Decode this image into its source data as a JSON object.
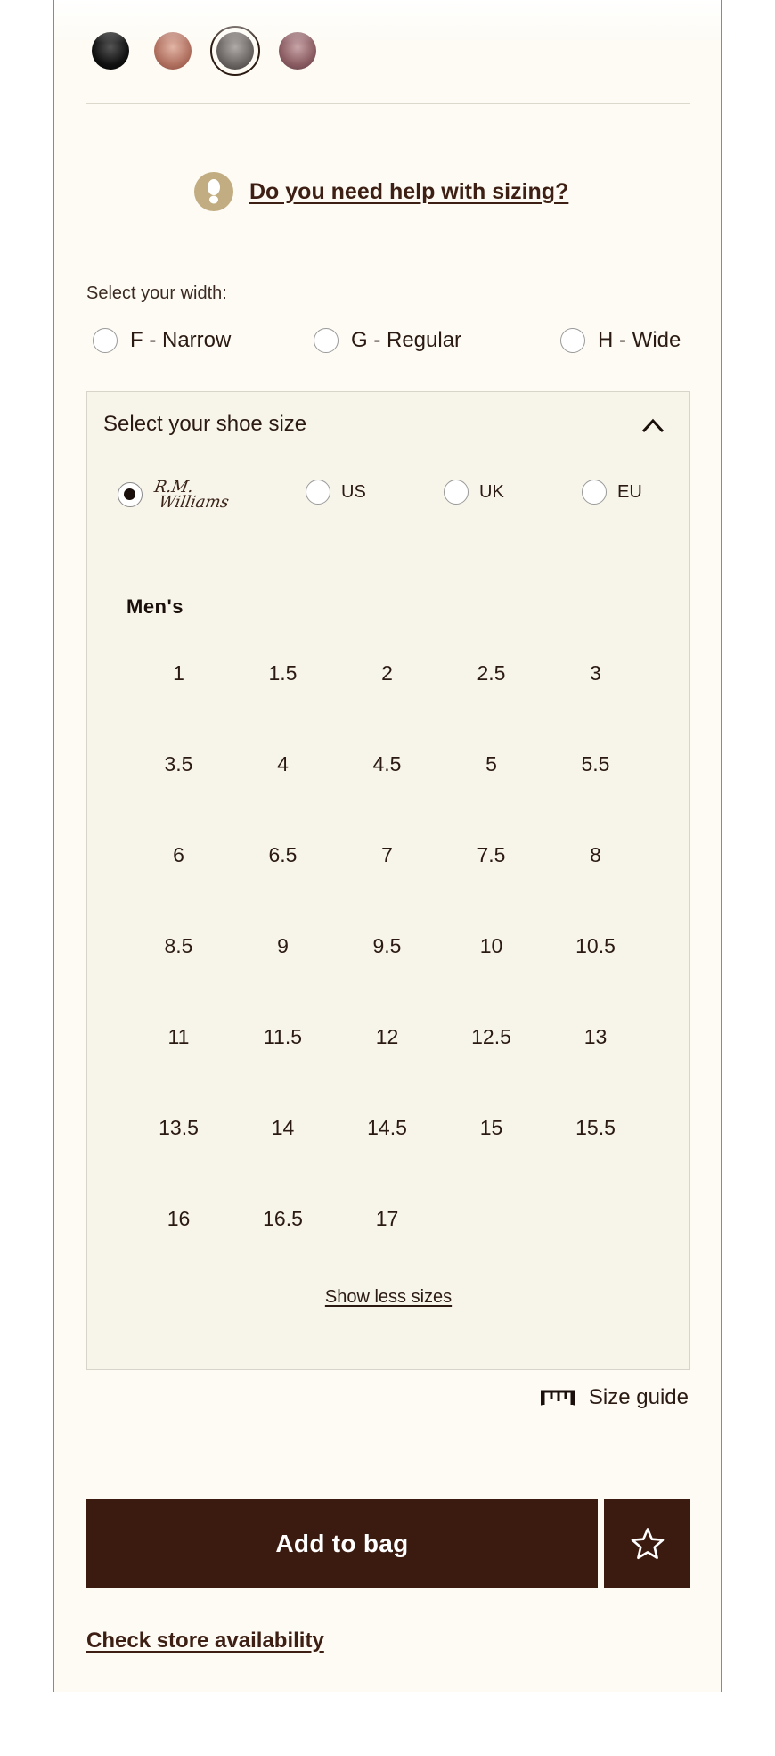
{
  "colors": {
    "accent": "#3b1a0f",
    "page_bg": "#fdfbf4",
    "panel_bg": "#f7f4ea",
    "help_icon_bg": "#c2ad82"
  },
  "swatches": [
    {
      "name": "black"
    },
    {
      "name": "tan"
    },
    {
      "name": "grey",
      "selected": true
    },
    {
      "name": "plum"
    }
  ],
  "help": {
    "icon": "footprint-icon",
    "text": "Do you need help with sizing?"
  },
  "width": {
    "label": "Select your width:",
    "options": [
      "F - Narrow",
      "G - Regular",
      "H - Wide"
    ]
  },
  "size_panel": {
    "heading": "Select your shoe size",
    "chevron_icon": "chevron-up-icon",
    "units": {
      "logo_line1": "R.M.",
      "logo_line2": "Williams",
      "us": "US",
      "uk": "UK",
      "eu": "EU",
      "selected": "R.M. Williams"
    },
    "group_label": "Men's",
    "sizes": [
      "1",
      "1.5",
      "2",
      "2.5",
      "3",
      "3.5",
      "4",
      "4.5",
      "5",
      "5.5",
      "6",
      "6.5",
      "7",
      "7.5",
      "8",
      "8.5",
      "9",
      "9.5",
      "10",
      "10.5",
      "11",
      "11.5",
      "12",
      "12.5",
      "13",
      "13.5",
      "14",
      "14.5",
      "15",
      "15.5",
      "16",
      "16.5",
      "17"
    ],
    "show_less": "Show less sizes"
  },
  "size_guide": {
    "icon": "ruler-icon",
    "label": "Size guide"
  },
  "add_to_bag": "Add to bag",
  "wishlist_icon": "star-icon",
  "store_link": "Check store availability"
}
